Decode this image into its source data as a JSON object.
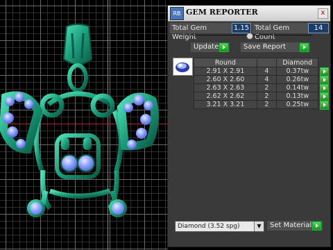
{
  "panel": {
    "title": "GEM REPORTER",
    "app_icon_text": "RB",
    "close_label": "x",
    "total_gem_weight_label": "Total Gem Weight",
    "total_gem_weight_value": "1.15",
    "total_gem_count_label": "Total Gem Count",
    "total_gem_count_value": "14",
    "update_label": "Update",
    "save_report_label": "Save Report"
  },
  "table": {
    "headers": [
      "Round",
      "",
      "Diamond"
    ],
    "rows": [
      {
        "size": "2.91 X 2.91",
        "count": "4",
        "weight": "0.37tw"
      },
      {
        "size": "2.60 X 2.60",
        "count": "4",
        "weight": "0.26tw"
      },
      {
        "size": "2.63 X 2.63",
        "count": "2",
        "weight": "0.14tw"
      },
      {
        "size": "2.62 X 2.62",
        "count": "2",
        "weight": "0.13tw"
      },
      {
        "size": "3.21 X 3.21",
        "count": "2",
        "weight": "0.25tw"
      }
    ]
  },
  "material": {
    "selected": "Diamond     (3.52 spg)",
    "set_label": "Set Material"
  },
  "icons": {
    "gem_thumb": "round-gem-icon",
    "go": "green-arrow-icon"
  },
  "colors": {
    "metal": "#1f9c7c",
    "gem": "#7d9bff",
    "value_box": "#1c3d68",
    "go_button": "#2fb32c"
  }
}
